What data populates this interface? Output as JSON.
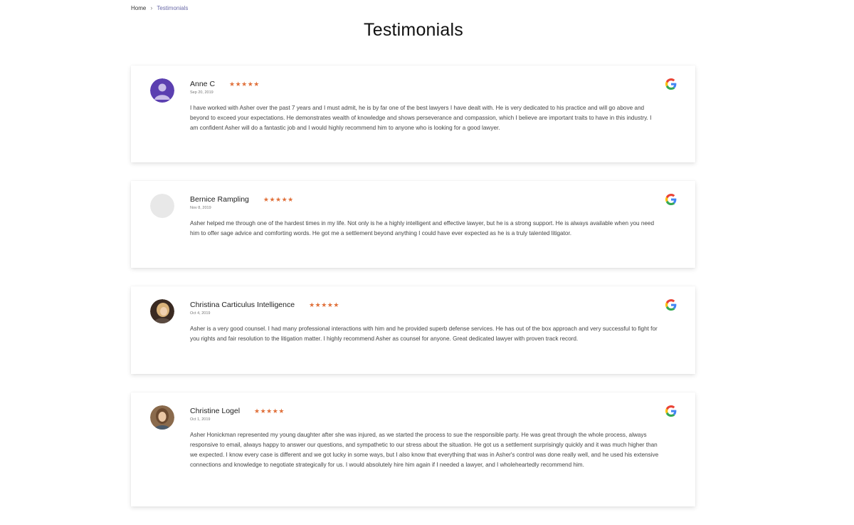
{
  "breadcrumb": {
    "home": "Home",
    "separator": "›",
    "current": "Testimonials"
  },
  "page": {
    "title": "Testimonials"
  },
  "colors": {
    "star": "#e0703a",
    "breadcrumb_current": "#6a6aa8"
  },
  "reviews": [
    {
      "name": "Anne C",
      "stars": "★★★★★",
      "date": "Sep 20, 2019",
      "text": "I have worked with Asher over the past 7 years and I must admit, he is by far one of the best lawyers I have dealt with. He is very dedicated to his practice and will go above and beyond to exceed your expectations. He demonstrates wealth of knowledge and shows perseverance and compassion, which I believe are important traits to have in this industry. I am confident Asher will do a fantastic job and I would highly recommend him to anyone who is looking for a good lawyer.",
      "avatar": "default-user-avatar",
      "source_icon": "google-icon"
    },
    {
      "name": "Bernice Rampling",
      "stars": "★★★★★",
      "date": "Nov 8, 2019",
      "text": "Asher helped me through one of the hardest times in my life. Not only is he a highly intelligent and effective lawyer, but he is a strong support. He is always available when you need him to offer sage advice and comforting words. He got me a settlement beyond anything I could have ever expected as he is a truly talented litigator.",
      "avatar": "blank-avatar",
      "source_icon": "google-icon"
    },
    {
      "name": "Christina Carticulus Intelligence",
      "stars": "★★★★★",
      "date": "Oct 4, 2019",
      "text": "Asher is a very good counsel. I had many professional interactions with him and he provided superb defense services. He has out of the box approach and very successful to fight for you rights and fair resolution to the litigation matter. I highly recommend Asher as counsel for anyone. Great dedicated lawyer with proven track record.",
      "avatar": "photo-avatar",
      "source_icon": "google-icon"
    },
    {
      "name": "Christine Logel",
      "stars": "★★★★★",
      "date": "Oct 1, 2019",
      "text": "Asher Honickman represented my young daughter after she was injured, as we started the process to sue the responsible party. He was great through the whole process, always responsive to email, always happy to answer our questions, and sympathetic to our stress about the situation. He got us a settlement surprisingly quickly and it was much higher than we expected. I know every case is different and we got lucky in some ways, but I also know that everything that was in Asher's control was done really well, and he used his extensive connections and knowledge to negotiate strategically for us. I would absolutely hire him again if I needed a lawyer, and I wholeheartedly recommend him.",
      "avatar": "photo-avatar",
      "source_icon": "google-icon"
    }
  ]
}
